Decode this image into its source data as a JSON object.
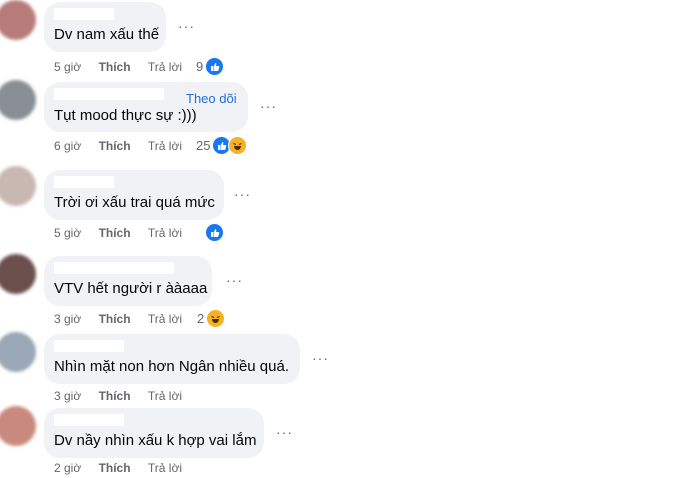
{
  "comments": [
    {
      "text": "Dv nam xấu thế",
      "time": "5 giờ",
      "like": "Thích",
      "reply": "Trả lời",
      "reaction_count": "9",
      "reactions": [
        "like-icon"
      ],
      "avatar_color": "#b77c7a"
    },
    {
      "text": "Tụt mood thực sự :)))",
      "follow": "Theo dõi",
      "time": "6 giờ",
      "like": "Thích",
      "reply": "Trả lời",
      "reaction_count": "25",
      "reactions": [
        "like-icon",
        "haha-icon"
      ],
      "avatar_color": "#8a8f95"
    },
    {
      "text": "Trời ơi xấu trai quá mức",
      "time": "5 giờ",
      "like": "Thích",
      "reply": "Trả lời",
      "reaction_count": "",
      "reactions": [
        "like-icon"
      ],
      "avatar_color": "#c9b8b2"
    },
    {
      "text": "VTV hết người r ààaaa",
      "time": "3 giờ",
      "like": "Thích",
      "reply": "Trả lời",
      "reaction_count": "2",
      "reactions": [
        "haha-icon"
      ],
      "avatar_color": "#6b4f4c"
    },
    {
      "text": "Nhìn mặt non hơn Ngân nhiều quá.",
      "time": "3 giờ",
      "like": "Thích",
      "reply": "Trả lời",
      "reaction_count": "",
      "reactions": [],
      "avatar_color": "#9aa7b7"
    },
    {
      "text": "Dv nầy nhìn xấu k hợp vai lắm",
      "time": "2 giờ",
      "like": "Thích",
      "reply": "Trả lời",
      "reaction_count": "",
      "reactions": [],
      "avatar_color": "#c98a7d"
    }
  ],
  "more_label": "···"
}
